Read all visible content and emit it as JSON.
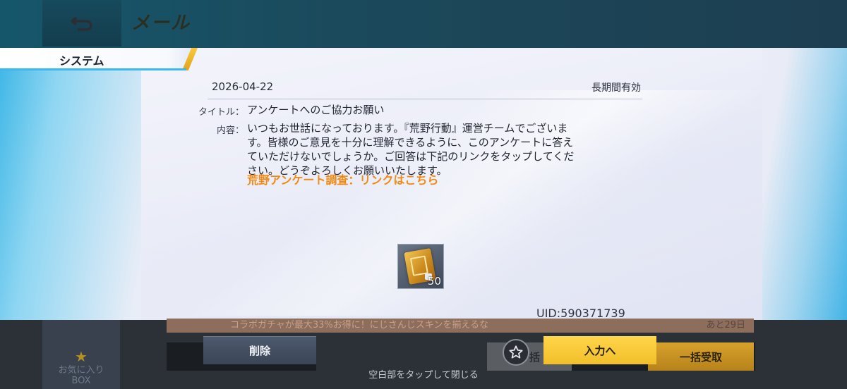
{
  "header": {
    "title": "メール",
    "back_icon": "back-arrow-icon"
  },
  "tab": {
    "label": "システム"
  },
  "mail": {
    "date": "2026-04-22",
    "validity": "長期間有効",
    "title_label": "タイトル：",
    "title": "アンケートへのご協力お願い",
    "content_label": "内容：",
    "content_lines": [
      "いつもお世話になっております。『荒野行動』運営チームでございま",
      "す。皆様のご意見を十分に理解できるように、このアンケートに答え",
      "ていただけないでしょうか。ご回答は下記のリンクをタップしてくだ",
      "さい。どうぞよろしくお願いいたします。"
    ],
    "link_text": "荒野アンケート調査：リンクはこちら"
  },
  "reward": {
    "quantity": "50",
    "icon": "gold-voucher-icon"
  },
  "uid": "UID:590371739",
  "behind": {
    "notice": "コラボガチャが最大33%お得に！にじさんじスキンを揃えるな",
    "remaining": "あと29日"
  },
  "favorites": {
    "line1": "お気に入り",
    "line2": "BOX"
  },
  "buttons": {
    "delete": "削除",
    "input": "入力へ",
    "bulk": "一括",
    "bulk_receive": "一括受取"
  },
  "close_hint": "空白部をタップして閉じる",
  "colors": {
    "accent_blue": "#38b8ef",
    "link_orange": "#f28a12",
    "gold": "#f2bf2a"
  }
}
